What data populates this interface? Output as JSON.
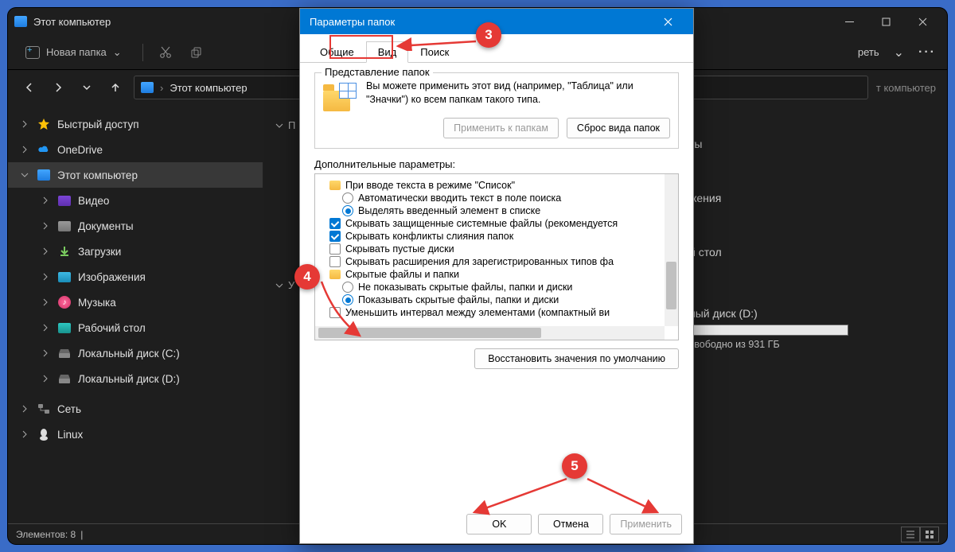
{
  "explorer": {
    "title": "Этот компьютер",
    "toolbar": {
      "new_folder": "Новая папка",
      "more_label": "реть"
    },
    "address": {
      "path": "Этот компьютер",
      "search_placeholder": "т компьютер"
    },
    "sidebar": {
      "quick": "Быстрый доступ",
      "onedrive": "OneDrive",
      "thispc": "Этот компьютер",
      "video": "Видео",
      "docs": "Документы",
      "downloads": "Загрузки",
      "pictures": "Изображения",
      "music": "Музыка",
      "desktop": "Рабочий стол",
      "drive_c": "Локальный диск (C:)",
      "drive_d": "Локальный диск (D:)",
      "network": "Сеть",
      "linux": "Linux"
    },
    "main": {
      "group1_prefix": "П",
      "group2_prefix": "У",
      "partial1": "ты",
      "partial2": "жения",
      "partial3": "й стол",
      "drive_label": "ный диск (D:)",
      "drive_free": "свободно из 931 ГБ"
    },
    "status": {
      "count_label": "Элементов: 8"
    }
  },
  "dialog": {
    "title": "Параметры папок",
    "tabs": {
      "general": "Общие",
      "view": "Вид",
      "search": "Поиск"
    },
    "folder_views": {
      "legend": "Представление папок",
      "text": "Вы можете применить этот вид (например, \"Таблица\" или \"Значки\") ко всем папкам такого типа.",
      "apply_btn": "Применить к папкам",
      "reset_btn": "Сброс вида папок"
    },
    "advanced": {
      "label": "Дополнительные параметры:",
      "items": [
        {
          "type": "folder",
          "text": "При вводе текста в режиме \"Список\""
        },
        {
          "type": "radio",
          "checked": false,
          "lvl": 2,
          "text": "Автоматически вводить текст в поле поиска"
        },
        {
          "type": "radio",
          "checked": true,
          "lvl": 2,
          "text": "Выделять введенный элемент в списке"
        },
        {
          "type": "check",
          "checked": true,
          "text": "Скрывать защищенные системные файлы (рекомендуется"
        },
        {
          "type": "check",
          "checked": true,
          "text": "Скрывать конфликты слияния папок"
        },
        {
          "type": "check",
          "checked": false,
          "text": "Скрывать пустые диски"
        },
        {
          "type": "check",
          "checked": false,
          "text": "Скрывать расширения для зарегистрированных типов фа"
        },
        {
          "type": "folder",
          "text": "Скрытые файлы и папки"
        },
        {
          "type": "radio",
          "checked": false,
          "lvl": 2,
          "text": "Не показывать скрытые файлы, папки и диски"
        },
        {
          "type": "radio",
          "checked": true,
          "lvl": 2,
          "text": "Показывать скрытые файлы, папки и диски"
        },
        {
          "type": "check",
          "checked": false,
          "text": "Уменьшить интервал между элементами (компактный ви"
        }
      ],
      "restore_btn": "Восстановить значения по умолчанию"
    },
    "footer": {
      "ok": "OK",
      "cancel": "Отмена",
      "apply": "Применить"
    }
  },
  "callouts": {
    "c3": "3",
    "c4": "4",
    "c5": "5"
  }
}
